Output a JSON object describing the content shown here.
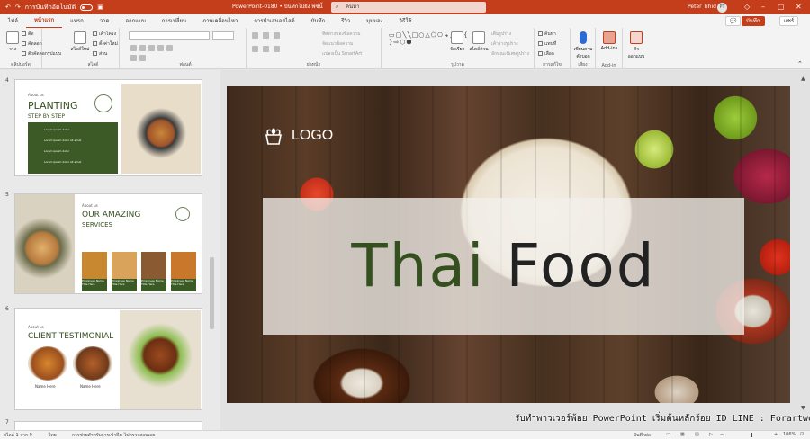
{
  "titlebar": {
    "autosave_label": "การบันทึกอัตโนมัติ",
    "title": "PowerPoint-0180 • บันทึกไปยัง พีซีนี้",
    "search_placeholder": "ค้นหา",
    "user_name": "Peter Tihid",
    "user_initials": "PT"
  },
  "tabs": [
    "ไฟล์",
    "หน้าแรก",
    "แทรก",
    "วาด",
    "ออกแบบ",
    "การเปลี่ยน",
    "ภาพเคลื่อนไหว",
    "การนำเสนอสไลด์",
    "บันทึก",
    "รีวิว",
    "มุมมอง",
    "วิธีใช้"
  ],
  "active_tab": "หน้าแรก",
  "header_buttons": {
    "record": "บันทึก",
    "share": "แชร์"
  },
  "ribbon": {
    "clipboard": {
      "paste": "วาง",
      "cut": "ตัด",
      "copy": "คัดลอก",
      "format_painter": "ตัวคัดลอกรูปแบบ",
      "label": "คลิปบอร์ด"
    },
    "slides": {
      "new_slide": "สไลด์ใหม่",
      "layout": "เค้าโครง",
      "reset": "ตั้งค่าใหม่",
      "section": "ส่วน",
      "label": "สไลด์"
    },
    "font": {
      "label": "ฟอนต์"
    },
    "paragraph": {
      "text_direction": "ทิศทางของข้อความ",
      "align_text": "จัดแนวข้อความ",
      "smartart": "แปลงเป็น SmartArt",
      "label": "ย่อหน้า"
    },
    "drawing": {
      "shape_glyphs": "▭▢╲╲□○△⬠⎔↳⤴☆{ }⇨⬡⬢",
      "arrange": "จัดเรียง",
      "quick_styles": "สไตล์ด่วน",
      "fill": "เติมรูปร่าง",
      "outline": "เค้าร่างรูปร่าง",
      "effects": "ลักษณะพิเศษรูปร่าง",
      "label": "รูปวาด"
    },
    "editing": {
      "find": "ค้นหา",
      "replace": "แทนที่",
      "select": "เลือก",
      "label": "การแก้ไข"
    },
    "voice": {
      "dictate": "เขียนตามคำบอก",
      "label": "เสียง"
    },
    "addins": {
      "addins": "Add-ins",
      "label": "Add-in"
    },
    "designer": {
      "designer": "ตัวออกแบบ",
      "label": ""
    }
  },
  "thumbnails": [
    {
      "num": "4",
      "about": "About us",
      "title_line1": "PLANTING",
      "title_line2": "STEP BY STEP",
      "items": [
        "Lorem ipsum dolor",
        "Lorem ipsum dolor sit amet",
        "Lorem ipsum dolor",
        "Lorem ipsum dolor sit amet"
      ]
    },
    {
      "num": "5",
      "about": "About us",
      "title_line1": "OUR AMAZING",
      "title_line2": "SERVICES",
      "captions": [
        "Employee Name Title Here",
        "Employee Name Title Here",
        "Employee Name Title Here",
        "Employee Name Title Here"
      ]
    },
    {
      "num": "6",
      "about": "About us",
      "title": "CLIENT TESTIMONIAL",
      "names": [
        "Name Here",
        "Name Here"
      ]
    },
    {
      "num": "7"
    }
  ],
  "slide": {
    "logo": "LOGO",
    "title_word1": "Thai",
    "title_word2": "Food"
  },
  "watermark": "รับทำพาวเวอร์พ้อย PowerPoint เริ่มต้นหลักร้อย ID LINE : Forartwork",
  "statusbar": {
    "slide_info": "สไลด์ 1 จาก 9",
    "language": "ไทย",
    "accessibility": "การช่วยสำหรับการเข้าถึง: ไปตรวจสอบเลย",
    "notes": "บันทึกย่อ",
    "zoom": "106%"
  }
}
